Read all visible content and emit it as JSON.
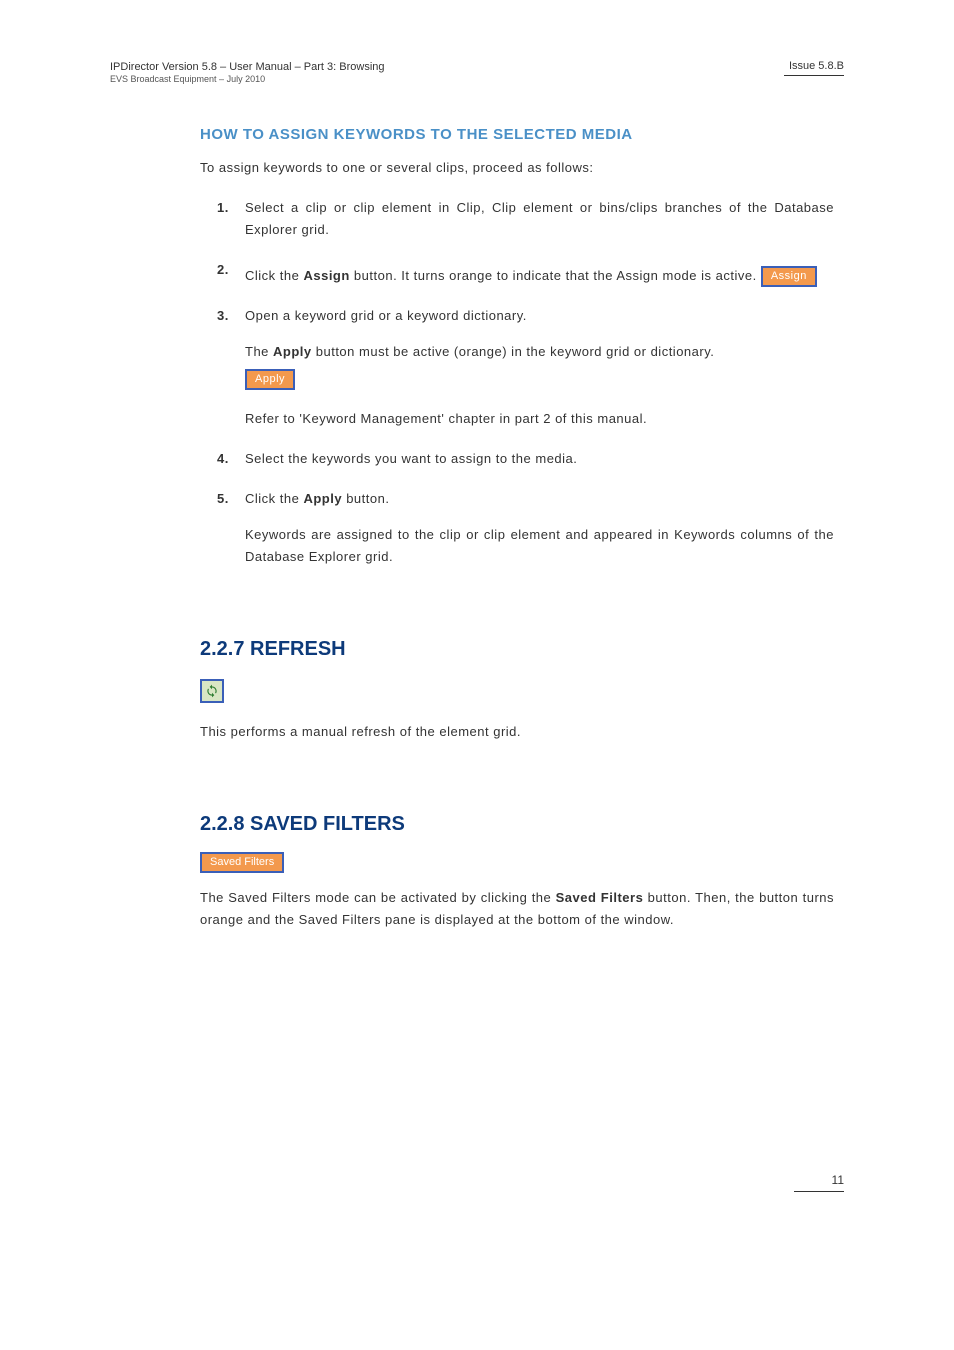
{
  "header": {
    "title": "IPDirector Version 5.8 – User Manual – Part 3: Browsing",
    "subtitle": "EVS Broadcast Equipment – July 2010",
    "issue": "Issue 5.8.B"
  },
  "section": {
    "heading": "HOW TO ASSIGN KEYWORDS TO THE SELECTED MEDIA",
    "intro": "To assign keywords to one or several clips, proceed as follows:"
  },
  "steps": {
    "s1": {
      "num": "1.",
      "text": "Select a clip or clip element in Clip, Clip element or bins/clips branches of the Database Explorer grid."
    },
    "s2": {
      "num": "2.",
      "pre": "Click the ",
      "bold": "Assign",
      "post": " button. It turns orange to indicate that the Assign mode is active.",
      "btn": "Assign"
    },
    "s3": {
      "num": "3.",
      "text": "Open a keyword grid or a keyword dictionary.",
      "line2_pre": "The ",
      "line2_bold": "Apply",
      "line2_post": " button must be active (orange) in the keyword grid or dictionary.",
      "btn": "Apply",
      "line3_pre": "Refer to ",
      "line3_quote": "'Keyword Management'",
      "line3_post": " chapter in part 2 of this manual."
    },
    "s4": {
      "num": "4.",
      "text": "Select the keywords you want to assign to the media."
    },
    "s5": {
      "num": "5.",
      "pre": "Click the ",
      "bold": "Apply",
      "post": " button.",
      "result": "Keywords are assigned to the clip or clip element and appeared in Keywords columns of the Database Explorer grid."
    }
  },
  "refresh": {
    "heading": "2.2.7 REFRESH",
    "text": "This performs a manual refresh of the element grid."
  },
  "savedfilters": {
    "heading": "2.2.8 SAVED FILTERS",
    "btn": "Saved Filters",
    "p_pre": "The Saved Filters mode can be activated by clicking the ",
    "p_bold": "Saved Filters",
    "p_post": " button. Then, the button turns orange and the Saved Filters pane is displayed at the bottom of the window."
  },
  "footer": {
    "page": "11"
  }
}
